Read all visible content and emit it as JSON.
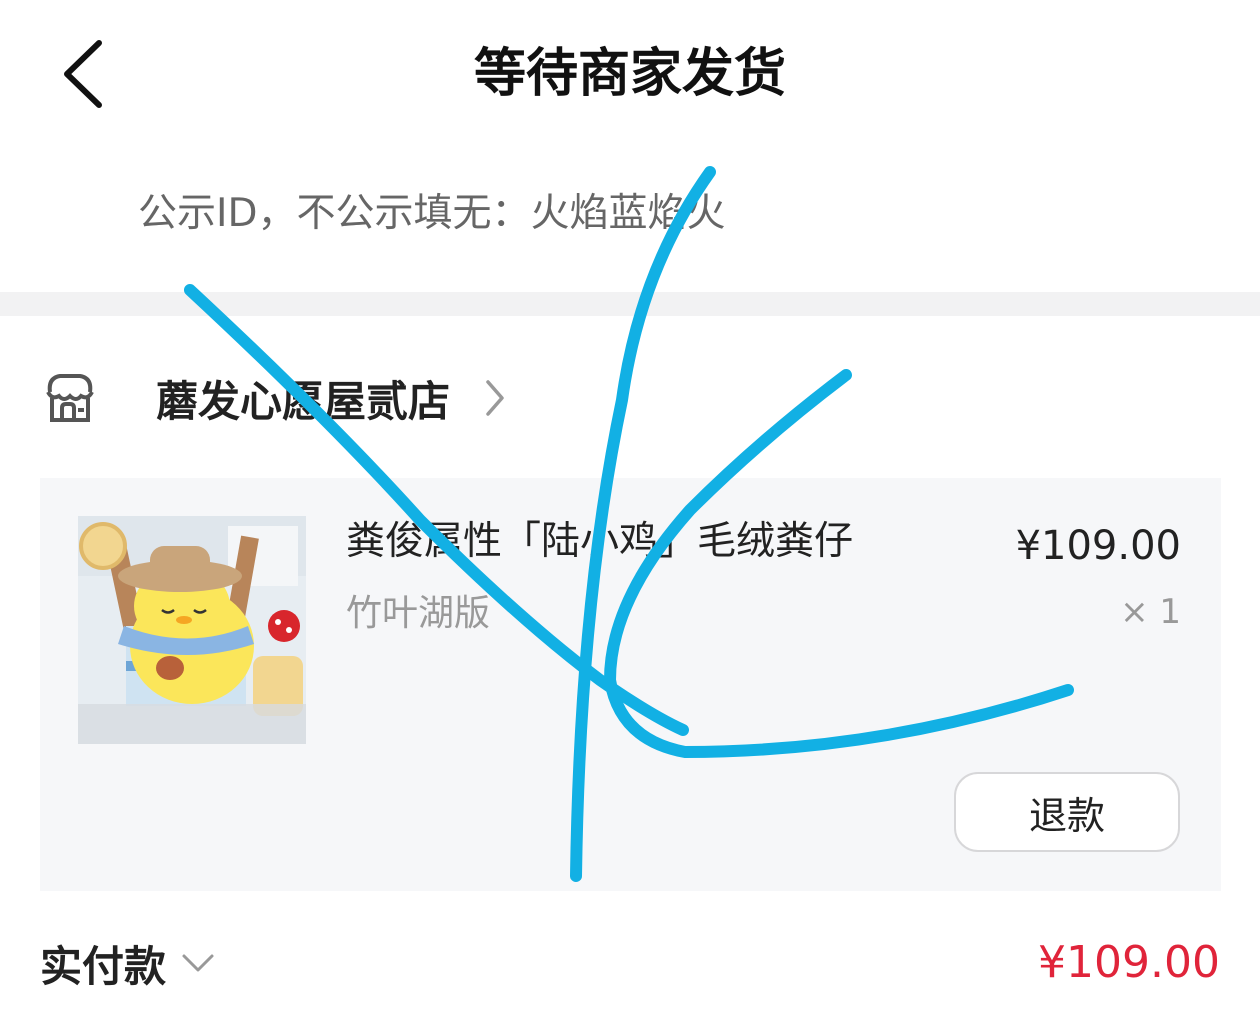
{
  "header": {
    "title": "等待商家发货"
  },
  "note": {
    "text": "公示ID，不公示填无：火焰蓝焰火"
  },
  "store": {
    "name": "蘑发心愿屋贰店"
  },
  "order": {
    "item_name": "粪俊属性「陆小鸡」毛绒粪仔",
    "spec": "竹叶湖版",
    "price": "¥109.00",
    "quantity": "× 1",
    "refund_label": "退款"
  },
  "summary": {
    "paid_label": "实付款",
    "paid_amount": "¥109.00"
  },
  "colors": {
    "accent_red": "#e0243a",
    "scribble_blue": "#12b0e4",
    "divider_gray": "#f2f2f3",
    "card_bg": "#f6f7f9"
  },
  "icons": [
    "back-arrow-icon",
    "store-icon",
    "chevron-right-icon",
    "chevron-down-icon"
  ]
}
